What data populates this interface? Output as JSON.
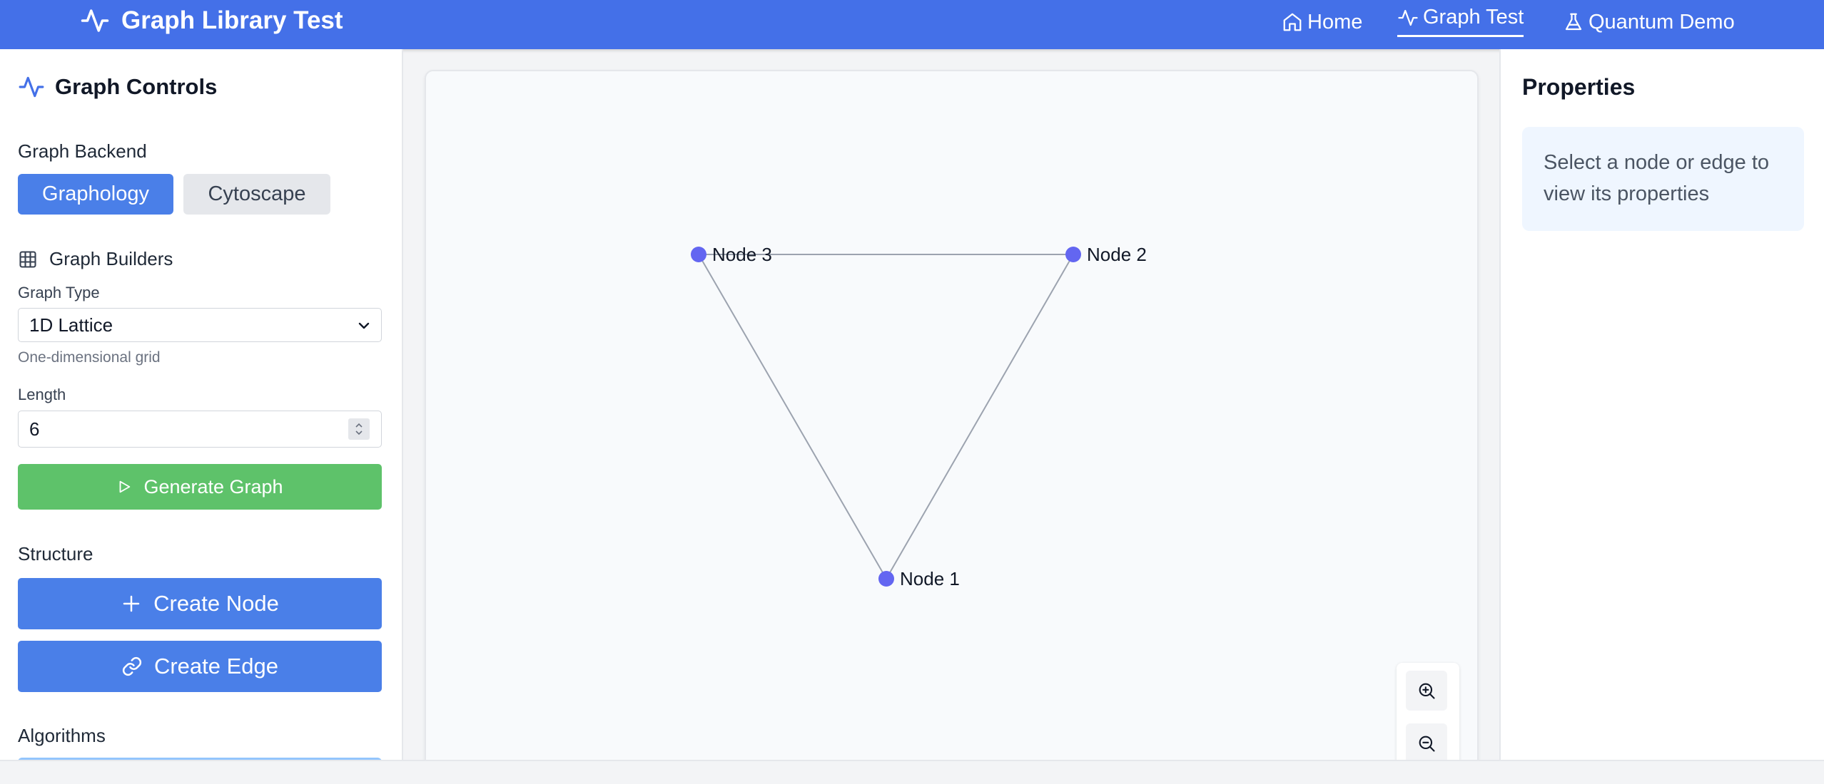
{
  "header": {
    "title": "Graph Library Test",
    "nav": [
      {
        "label": "Home",
        "icon": "home-icon",
        "active": false
      },
      {
        "label": "Graph Test",
        "icon": "activity-icon",
        "active": true
      },
      {
        "label": "Quantum Demo",
        "icon": "flask-icon",
        "active": false
      }
    ]
  },
  "controls": {
    "title": "Graph Controls",
    "backend_label": "Graph Backend",
    "backends": [
      {
        "label": "Graphology",
        "selected": true
      },
      {
        "label": "Cytoscape",
        "selected": false
      }
    ],
    "builders_label": "Graph Builders",
    "graph_type_label": "Graph Type",
    "graph_type_value": "1D Lattice",
    "graph_type_hint": "One-dimensional grid",
    "length_label": "Length",
    "length_value": "6",
    "generate_label": "Generate Graph",
    "structure_label": "Structure",
    "create_node_label": "Create Node",
    "create_edge_label": "Create Edge",
    "algorithms_label": "Algorithms"
  },
  "graph": {
    "node_color": "#6366f1",
    "edge_color": "#9ca3af",
    "nodes": [
      {
        "id": "n1",
        "label": "Node 1"
      },
      {
        "id": "n2",
        "label": "Node 2"
      },
      {
        "id": "n3",
        "label": "Node 3"
      }
    ],
    "edges": [
      {
        "source": "n3",
        "target": "n2"
      },
      {
        "source": "n3",
        "target": "n1"
      },
      {
        "source": "n2",
        "target": "n1"
      }
    ]
  },
  "properties": {
    "title": "Properties",
    "placeholder": "Select a node or edge to view its properties"
  },
  "colors": {
    "primary": "#4470e8",
    "button_blue": "#4a7fe8",
    "button_green": "#5ec26a"
  }
}
